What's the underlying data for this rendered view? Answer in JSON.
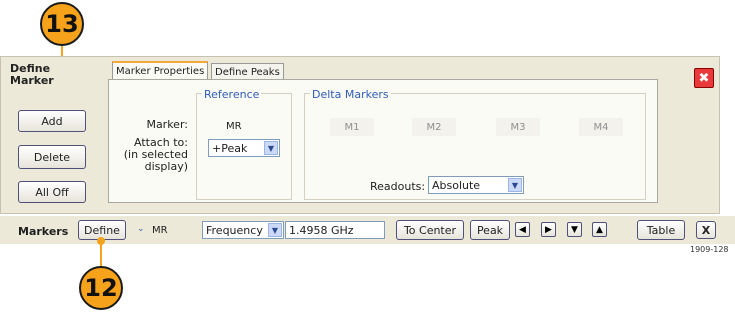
{
  "callouts": {
    "top": "13",
    "bottom": "12"
  },
  "sidebar": {
    "title_line1": "Define",
    "title_line2": "Marker",
    "add": "Add",
    "delete": "Delete",
    "all_off": "All Off"
  },
  "tabs": [
    {
      "label": "Marker Properties"
    },
    {
      "label": "Define Peaks"
    }
  ],
  "reference": {
    "group_label": "Reference",
    "marker_label": "Marker:",
    "marker_value": "MR",
    "attach_label": "Attach to:",
    "attach_sub1": "(in selected",
    "attach_sub2": "display)",
    "attach_value": "+Peak"
  },
  "delta": {
    "group_label": "Delta Markers",
    "markers": [
      "M1",
      "M2",
      "M3",
      "M4"
    ],
    "readouts_label": "Readouts:",
    "readouts_value": "Absolute"
  },
  "toolbar": {
    "markers_label": "Markers",
    "define": "Define",
    "active_marker": "MR",
    "param_select": "Frequency",
    "value": "1.4958 GHz",
    "to_center": "To Center",
    "peak": "Peak",
    "table": "Table",
    "close": "X"
  },
  "figure_id": "1909-128",
  "colors": {
    "callout": "#f7a21b",
    "tab_accent": "#f3a83b",
    "close_red": "#e83a3a",
    "group_label": "#2f5db5"
  }
}
